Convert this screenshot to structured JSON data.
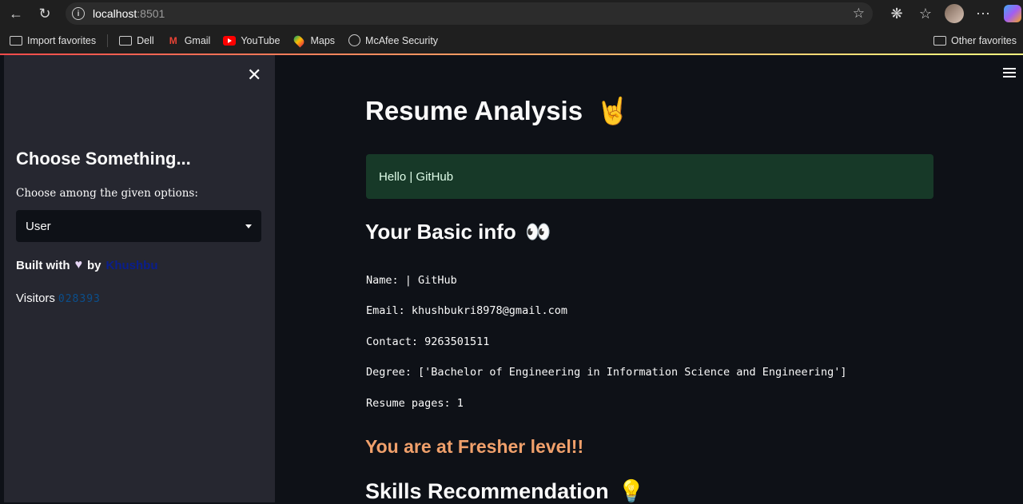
{
  "browser": {
    "url_host": "localhost",
    "url_port": ":8501",
    "bookmarks": [
      {
        "label": "Import favorites",
        "icon": "import-icon"
      },
      {
        "label": "Dell",
        "icon": "folder-icon"
      },
      {
        "label": "Gmail",
        "icon": "gmail-icon"
      },
      {
        "label": "YouTube",
        "icon": "youtube-icon"
      },
      {
        "label": "Maps",
        "icon": "maps-icon"
      },
      {
        "label": "McAfee Security",
        "icon": "globe-icon"
      }
    ],
    "other_favorites": "Other favorites"
  },
  "sidebar": {
    "title": "Choose Something...",
    "select_label": "Choose among the given options:",
    "select_value": "User",
    "built_prefix": "Built with",
    "built_by": "by",
    "author": "Khushbu",
    "visitors_label": "Visitors",
    "visitors_count": "028393"
  },
  "main": {
    "title": "Resume Analysis",
    "title_emoji": "🤘",
    "success_message": "Hello | GitHub",
    "basic_info_heading": "Your Basic info",
    "basic_info_emoji": "👀",
    "info_lines": [
      "Name: | GitHub",
      "Email: khushbukri8978@gmail.com",
      "Contact: 9263501511",
      "Degree: ['Bachelor of Engineering in Information Science and Engineering']",
      "Resume pages: 1"
    ],
    "level_message": "You are at Fresher level!!",
    "skills_heading": "Skills Recommendation",
    "skills_emoji": "💡"
  },
  "colors": {
    "sidebar_bg": "#262730",
    "main_bg": "#0e1117",
    "success_bg": "#173928",
    "level_color": "#f0a06b",
    "author_color": "#0a1e8c"
  }
}
